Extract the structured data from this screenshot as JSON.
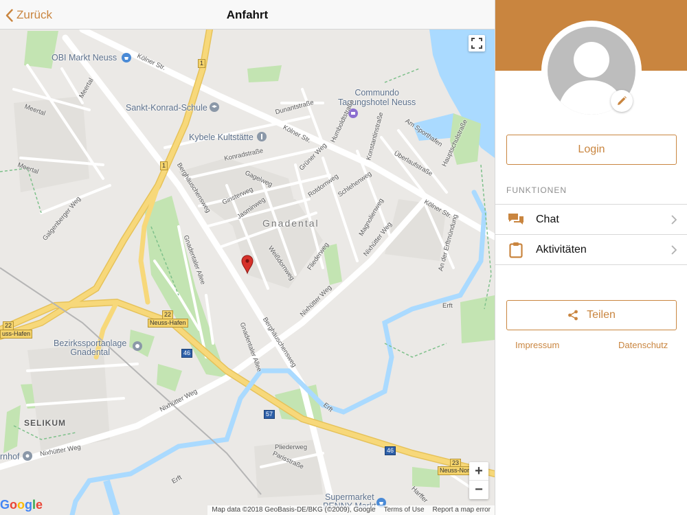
{
  "navbar": {
    "back_label": "Zurück",
    "title": "Anfahrt"
  },
  "map": {
    "pois": {
      "obi": "OBI Markt Neuss",
      "commundo": "Commundo\nTagungshotel Neuss",
      "konrad": "Sankt-Konrad-Schule",
      "kybele": "Kybele Kultstätte",
      "bezirk": "Bezirkssportanlage\nGnadental",
      "supermarket": "Supermarket\nPENNY Markt",
      "hornhof": "rnhof"
    },
    "districts": {
      "gnadental": "Gnadental",
      "selikum": "SELIKUM"
    },
    "streets": {
      "koelner1": "Kölner Str.",
      "koelner2": "Kölner Str.",
      "koelner3": "Kölner Str.",
      "berg1": "Berghäuschensweg",
      "berg2": "Berghäuschensweg",
      "nix1": "Nixhütter Weg",
      "nix2": "Nixhütter Weg",
      "nix3": "Nixhütter Weg",
      "nix4": "Nixhütter Weg",
      "erft1": "Erft",
      "erft2": "Erft",
      "erft3": "Erft",
      "gagel": "Gagelweg",
      "ginster": "Ginsterweg",
      "jasmin": "Jasminweg",
      "konrad": "Konradstraße",
      "gruener": "Grüner Weg",
      "rotdorn": "Rotdornweg",
      "schlehen": "Schlehenweg",
      "weissdorn": "Weißdornweg",
      "flieder": "Fliederweg",
      "magnolien": "Magnolienweg",
      "gnadentaler1": "Gnadentaler Allee",
      "gnadentaler2": "Gnadentaler Allee",
      "meertal1": "Meertal",
      "meertal2": "Meertal",
      "meertal3": "Meertal",
      "galgenberger": "Galgenberger Weg",
      "dunant": "Dunantstraße",
      "humboldt": "Humboldtstraße",
      "konstantin": "Konstantinstraße",
      "ueberlauf": "Überlaufstraße",
      "sporthafen": "Am Sporthafen",
      "hauptschule": "Hauptschulstraße",
      "erftmuendung": "An der Erftmündung",
      "paris": "Parisstraße",
      "pliederweg": "Pliederweg",
      "harffer": "Harffer"
    },
    "shields": {
      "b1a": "1",
      "b1b": "1",
      "a22a": "22",
      "a22b": "22",
      "exit_hafen": "Neuss-Hafen",
      "a46a": "46",
      "a46b": "46",
      "a57": "57",
      "a23": "23",
      "neuss_hafen_left": "uss-Hafen",
      "neuss_nord": "Neuss-Nor"
    },
    "attribution": {
      "data": "Map data ©2018 GeoBasis-DE/BKG (©2009), Google",
      "terms": "Terms of Use",
      "report": "Report a map error"
    },
    "google_logo": "Google",
    "zoom_in": "+",
    "zoom_out": "−"
  },
  "panel": {
    "login_label": "Login",
    "section_header": "FUNKTIONEN",
    "menu": [
      {
        "label": "Chat",
        "icon": "chat-icon"
      },
      {
        "label": "Aktivitäten",
        "icon": "clipboard-icon"
      }
    ],
    "share_label": "Teilen",
    "imprint_label": "Impressum",
    "privacy_label": "Datenschutz"
  },
  "colors": {
    "accent": "#c9853f",
    "water": "#aadaff",
    "park": "#c3e4b2",
    "road": "#ffffff",
    "highway": "#f7d87a"
  }
}
